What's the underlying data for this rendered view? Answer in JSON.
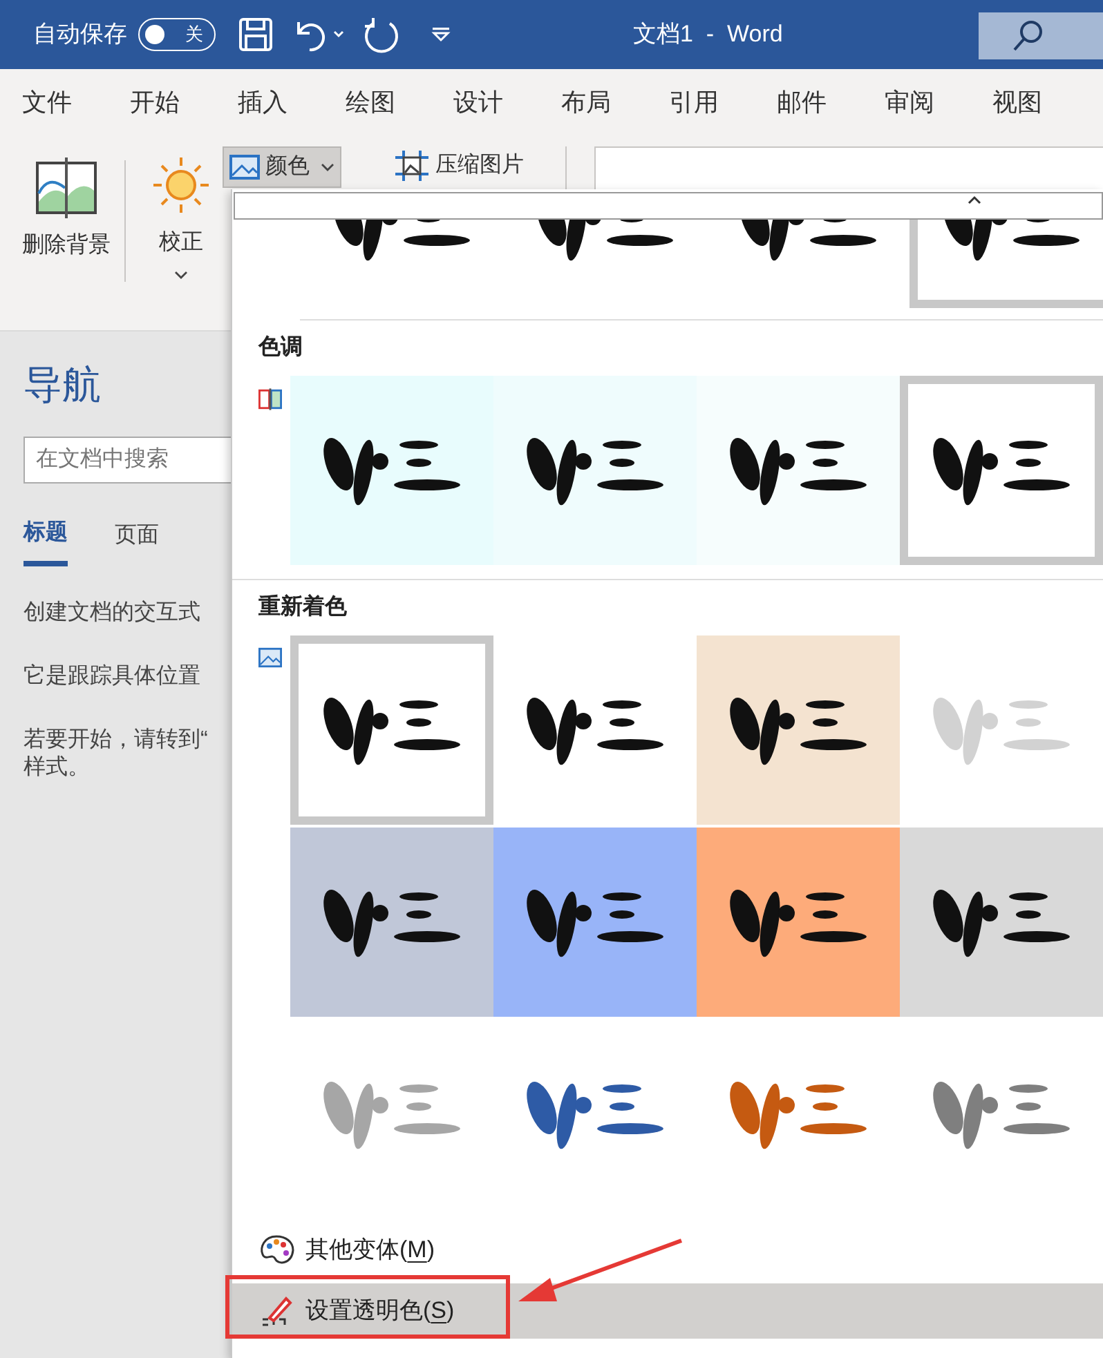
{
  "title_bar": {
    "autosave_label": "自动保存",
    "autosave_toggle": {
      "on": false,
      "label": "关"
    },
    "title": "文档1  -  Word"
  },
  "menu_tabs": [
    {
      "label": "文件"
    },
    {
      "label": "开始"
    },
    {
      "label": "插入"
    },
    {
      "label": "绘图"
    },
    {
      "label": "设计"
    },
    {
      "label": "布局"
    },
    {
      "label": "引用"
    },
    {
      "label": "邮件"
    },
    {
      "label": "审阅"
    },
    {
      "label": "视图"
    }
  ],
  "ribbon": {
    "buttons": [
      {
        "label": "删除背景",
        "kind": "large",
        "pressed": false
      },
      {
        "label": "校正",
        "kind": "large-dropdown",
        "pressed": false
      },
      {
        "label": "颜色",
        "kind": "small-dropdown",
        "pressed": true
      },
      {
        "label": "压缩图片",
        "kind": "small",
        "pressed": false
      }
    ]
  },
  "navigation": {
    "title": "导航",
    "search": {
      "placeholder": "在文档中搜索"
    },
    "tabs": [
      {
        "label": "标题",
        "selected": true
      },
      {
        "label": "页面",
        "selected": false
      }
    ],
    "lines": [
      "创建文档的交互式",
      "它是跟踪具体位置",
      "若要开始，请转到“",
      "样式。"
    ]
  },
  "color_menu": {
    "saturation_row": [
      {
        "kind": "picture",
        "selected": false,
        "color": "#ffffff",
        "ink": {
          "color": "#111111"
        }
      },
      {
        "kind": "picture",
        "selected": false,
        "color": "#ffffff",
        "ink": {
          "color": "#111111"
        }
      },
      {
        "kind": "picture",
        "selected": false,
        "color": "#ffffff",
        "ink": {
          "color": "#111111"
        }
      },
      {
        "kind": "picture",
        "selected": true,
        "color": "#ffffff",
        "ink": {
          "color": "#111111"
        }
      }
    ],
    "sections": [
      {
        "heading": "色调",
        "items": [
          {
            "kind": "picture",
            "selected": false,
            "color": "#e8fcfd",
            "ink": {
              "color": "#111111"
            }
          },
          {
            "kind": "picture",
            "selected": false,
            "color": "#effcfd",
            "ink": {
              "color": "#111111"
            }
          },
          {
            "kind": "picture",
            "selected": false,
            "color": "#f6fdfd",
            "ink": {
              "color": "#111111"
            }
          },
          {
            "kind": "picture",
            "selected": true,
            "color": "#ffffff",
            "ink": {
              "color": "#111111"
            }
          }
        ]
      },
      {
        "heading": "重新着色",
        "items": [
          {
            "kind": "picture",
            "selected": true,
            "color": "#ffffff",
            "ink": {
              "color": "#111111"
            }
          },
          {
            "kind": "picture",
            "selected": false,
            "color": "#ffffff",
            "ink": {
              "color": "#111111"
            }
          },
          {
            "kind": "picture",
            "selected": false,
            "color": "#f4e3d0",
            "ink": {
              "color": "#111111"
            }
          },
          {
            "kind": "picture",
            "selected": false,
            "color": "#ffffff",
            "ink": {
              "color": "#d2d2d2"
            }
          },
          {
            "kind": "picture",
            "selected": false,
            "color": "#c0c7d8",
            "ink": {
              "color": "#111111"
            }
          },
          {
            "kind": "picture",
            "selected": false,
            "color": "#98b4f8",
            "ink": {
              "color": "#111111"
            }
          },
          {
            "kind": "picture",
            "selected": false,
            "color": "#fdab7a",
            "ink": {
              "color": "#111111"
            }
          },
          {
            "kind": "picture",
            "selected": false,
            "color": "#d9d9d9",
            "ink": {
              "color": "#111111"
            }
          },
          {
            "kind": "picture",
            "selected": false,
            "color": "#ffffff",
            "ink": {
              "color": "#a6a6a6"
            }
          },
          {
            "kind": "picture",
            "selected": false,
            "color": "#ffffff",
            "ink": {
              "color": "#2e5ba6"
            }
          },
          {
            "kind": "picture",
            "selected": false,
            "color": "#ffffff",
            "ink": {
              "color": "#c55a11"
            }
          },
          {
            "kind": "picture",
            "selected": false,
            "color": "#ffffff",
            "ink": {
              "color": "#7f7f7f"
            }
          }
        ]
      }
    ],
    "commands": [
      {
        "kind": "palette",
        "before": "其他变体(",
        "access_key": "M",
        "after": ")",
        "highlighted": false
      },
      {
        "kind": "eyedropper",
        "before": "设置透明色(",
        "access_key": "S",
        "after": ")",
        "highlighted": true
      }
    ]
  }
}
